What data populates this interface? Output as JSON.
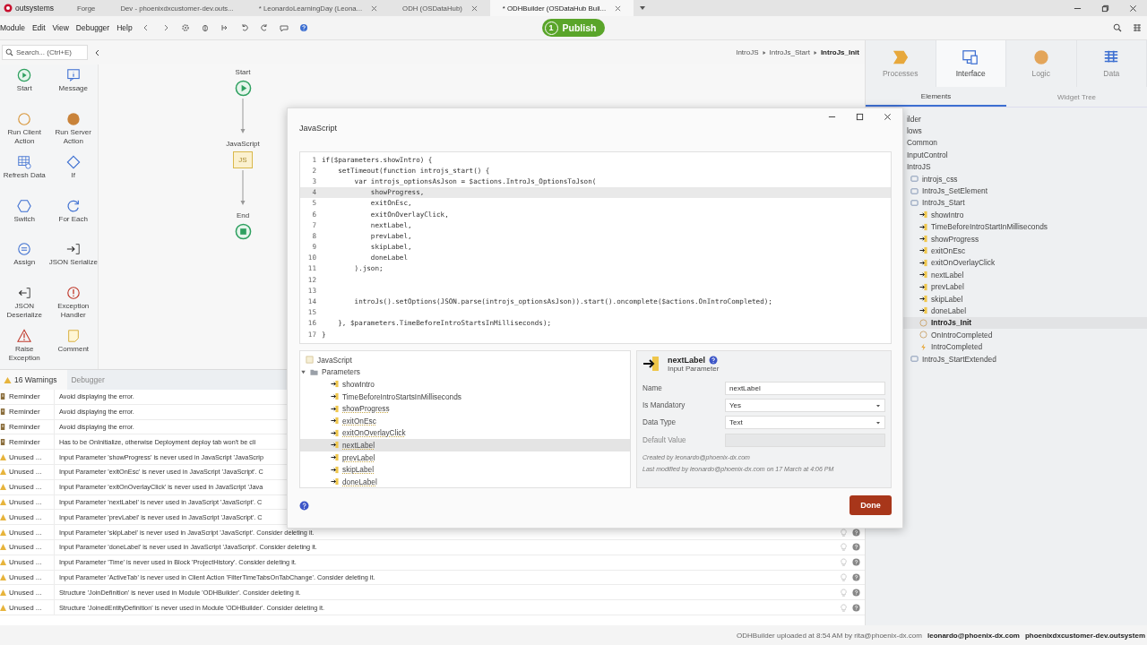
{
  "brand": "outsystems",
  "tabs": [
    {
      "label": "Forge",
      "selected": false,
      "closable": false
    },
    {
      "label": "Dev - phoenixdxcustomer-dev.outs...",
      "selected": false,
      "closable": false
    },
    {
      "label": "* LeonardoLearningDay (Leona...",
      "selected": false,
      "closable": true
    },
    {
      "label": "ODH (OSDataHub)",
      "selected": false,
      "closable": true
    },
    {
      "label": "* ODHBuilder (OSDataHub Buil...",
      "selected": true,
      "closable": true
    }
  ],
  "menu": [
    "Module",
    "Edit",
    "View",
    "Debugger",
    "Help"
  ],
  "publish": {
    "count": "1",
    "label": "Publish"
  },
  "search": {
    "placeholder": "Search... (Ctrl+E)"
  },
  "breadcrumb": [
    "IntroJS",
    "IntroJs_Start",
    "IntroJs_Init"
  ],
  "toolbox": [
    {
      "label": "Start",
      "kind": "start"
    },
    {
      "label": "Message",
      "kind": "message"
    },
    {
      "label": "Run Client Action",
      "kind": "client"
    },
    {
      "label": "Run Server Action",
      "kind": "server"
    },
    {
      "label": "Refresh Data",
      "kind": "refresh"
    },
    {
      "label": "If",
      "kind": "if"
    },
    {
      "label": "Switch",
      "kind": "switch"
    },
    {
      "label": "For Each",
      "kind": "foreach"
    },
    {
      "label": "Assign",
      "kind": "assign"
    },
    {
      "label": "JSON Serialize",
      "kind": "serialize"
    },
    {
      "label": "JSON Deserialize",
      "kind": "deserialize"
    },
    {
      "label": "Exception Handler",
      "kind": "exception"
    },
    {
      "label": "Raise Exception",
      "kind": "raise"
    },
    {
      "label": "Comment",
      "kind": "comment"
    }
  ],
  "flow": [
    {
      "label": "Start",
      "kind": "start"
    },
    {
      "label": "JavaScript",
      "kind": "js",
      "badge": "JS"
    },
    {
      "label": "End",
      "kind": "end"
    }
  ],
  "problems": {
    "tabs": [
      {
        "label": "16 Warnings",
        "selected": true
      },
      {
        "label": "Debugger",
        "selected": false
      }
    ],
    "rows": [
      {
        "kind": "reminder",
        "type": "Reminder",
        "message": "Avoid displaying the error."
      },
      {
        "kind": "reminder",
        "type": "Reminder",
        "message": "Avoid displaying the error."
      },
      {
        "kind": "reminder",
        "type": "Reminder",
        "message": "Avoid displaying the error."
      },
      {
        "kind": "reminder",
        "type": "Reminder",
        "message": "Has to be OnInitialize, otherwise Deployment deploy tab won't be cli"
      },
      {
        "kind": "unused",
        "type": "Unused ...",
        "message": "Input Parameter 'showProgress' is never used in JavaScript 'JavaScrip"
      },
      {
        "kind": "unused",
        "type": "Unused ...",
        "message": "Input Parameter 'exitOnEsc' is never used in JavaScript 'JavaScript'. C"
      },
      {
        "kind": "unused",
        "type": "Unused ...",
        "message": "Input Parameter 'exitOnOverlayClick' is never used in JavaScript 'Java"
      },
      {
        "kind": "unused",
        "type": "Unused ...",
        "message": "Input Parameter 'nextLabel' is never used in JavaScript 'JavaScript'. C"
      },
      {
        "kind": "unused",
        "type": "Unused ...",
        "message": "Input Parameter 'prevLabel' is never used in JavaScript 'JavaScript'. C"
      },
      {
        "kind": "unused",
        "type": "Unused ...",
        "message": "Input Parameter 'skipLabel' is never used in JavaScript 'JavaScript'. Consider deleting it."
      },
      {
        "kind": "unused",
        "type": "Unused ...",
        "message": "Input Parameter 'doneLabel' is never used in JavaScript 'JavaScript'. Consider deleting it."
      },
      {
        "kind": "unused",
        "type": "Unused ...",
        "message": "Input Parameter 'Time' is never used in Block 'ProjectHistory'. Consider deleting it."
      },
      {
        "kind": "unused",
        "type": "Unused ...",
        "message": "Input Parameter 'ActiveTab' is never used in Client Action 'FilterTimeTabsOnTabChange'. Consider deleting it."
      },
      {
        "kind": "unused",
        "type": "Unused ...",
        "message": "Structure 'JoinDefinition' is never used in Module 'ODHBuilder'. Consider deleting it."
      },
      {
        "kind": "unused",
        "type": "Unused ...",
        "message": "Structure 'JoinedEntityDefinition' is never used in Module 'ODHBuilder'. Consider deleting it."
      }
    ]
  },
  "right_panel": {
    "tabs": [
      {
        "label": "Processes",
        "kind": "processes",
        "selected": false
      },
      {
        "label": "Interface",
        "kind": "interface",
        "selected": true
      },
      {
        "label": "Logic",
        "kind": "logic",
        "selected": false
      },
      {
        "label": "Data",
        "kind": "data",
        "selected": false
      }
    ],
    "subtabs": [
      {
        "label": "Elements",
        "selected": true
      },
      {
        "label": "Widget Tree",
        "selected": false
      }
    ],
    "tree": [
      {
        "label": "ilder",
        "selected": false
      },
      {
        "label": "lows",
        "selected": false
      },
      {
        "label": "Common",
        "selected": false
      },
      {
        "label": "InputControl",
        "selected": false
      },
      {
        "label": "IntroJS",
        "selected": false,
        "children": [
          {
            "label": "introjs_css",
            "kind": "block",
            "selected": false
          },
          {
            "label": "IntroJs_SetElement",
            "kind": "block",
            "selected": false
          },
          {
            "label": "IntroJs_Start",
            "kind": "block",
            "selected": false,
            "children": [
              {
                "label": "showIntro",
                "kind": "param",
                "selected": false
              },
              {
                "label": "TimeBeforeIntroStartInMilliseconds",
                "kind": "param",
                "selected": false
              },
              {
                "label": "showProgress",
                "kind": "param",
                "selected": false
              },
              {
                "label": "exitOnEsc",
                "kind": "param",
                "selected": false
              },
              {
                "label": "exitOnOverlayClick",
                "kind": "param",
                "selected": false
              },
              {
                "label": "nextLabel",
                "kind": "param",
                "selected": false
              },
              {
                "label": "prevLabel",
                "kind": "param",
                "selected": false
              },
              {
                "label": "skipLabel",
                "kind": "param",
                "selected": false
              },
              {
                "label": "doneLabel",
                "kind": "param",
                "selected": false
              },
              {
                "label": "IntroJs_Init",
                "kind": "action",
                "selected": true
              },
              {
                "label": "OnIntroCompleted",
                "kind": "action",
                "selected": false
              },
              {
                "label": "IntroCompleted",
                "kind": "event",
                "selected": false
              }
            ]
          },
          {
            "label": "IntroJs_StartExtended",
            "kind": "block",
            "selected": false
          }
        ]
      }
    ]
  },
  "dialog": {
    "title": "JavaScript",
    "code": [
      {
        "n": "1",
        "text": "if($parameters.showIntro) {",
        "current": false
      },
      {
        "n": "2",
        "text": "    setTimeout(function introjs_start() {",
        "current": false
      },
      {
        "n": "3",
        "text": "        var introjs_optionsAsJson = $actions.IntroJs_OptionsToJson(",
        "current": false
      },
      {
        "n": "4",
        "text": "            showProgress,",
        "current": true
      },
      {
        "n": "5",
        "text": "            exitOnEsc,",
        "current": false
      },
      {
        "n": "6",
        "text": "            exitOnOverlayClick,",
        "current": false
      },
      {
        "n": "7",
        "text": "            nextLabel,",
        "current": false
      },
      {
        "n": "8",
        "text": "            prevLabel,",
        "current": false
      },
      {
        "n": "9",
        "text": "            skipLabel,",
        "current": false
      },
      {
        "n": "10",
        "text": "            doneLabel",
        "current": false
      },
      {
        "n": "11",
        "text": "        ).json;",
        "current": false
      },
      {
        "n": "12",
        "current": false
      },
      {
        "n": "13",
        "current": false
      },
      {
        "n": "14",
        "text": "        introJs().setOptions(JSON.parse(introjs_optionsAsJson)).start().oncomplete($actions.OnIntroCompleted);",
        "current": false
      },
      {
        "n": "15",
        "current": false
      },
      {
        "n": "16",
        "text": "    }, $parameters.TimeBeforeIntroStartsInMilliseconds);",
        "current": false
      },
      {
        "n": "17",
        "text": "}",
        "current": false
      }
    ],
    "tree": [
      {
        "label": "JavaScript",
        "kind": "js",
        "selected": false
      },
      {
        "label": "Parameters",
        "kind": "folder",
        "selected": false,
        "expanded": true,
        "children": [
          {
            "label": "showIntro",
            "kind": "param",
            "selected": false,
            "unused": false
          },
          {
            "label": "TimeBeforeIntroStartsInMilliseconds",
            "kind": "param",
            "selected": false,
            "unused": false
          },
          {
            "label": "showProgress",
            "kind": "param",
            "selected": false,
            "unused": true
          },
          {
            "label": "exitOnEsc",
            "kind": "param",
            "selected": false,
            "unused": true
          },
          {
            "label": "exitOnOverlayClick",
            "kind": "param",
            "selected": false,
            "unused": true
          },
          {
            "label": "nextLabel",
            "kind": "param",
            "selected": true,
            "unused": true
          },
          {
            "label": "prevLabel",
            "kind": "param",
            "selected": false,
            "unused": true
          },
          {
            "label": "skipLabel",
            "kind": "param",
            "selected": false,
            "unused": true
          },
          {
            "label": "doneLabel",
            "kind": "param",
            "selected": false,
            "unused": true
          }
        ]
      }
    ],
    "properties": {
      "name": "nextLabel",
      "type": "Input Parameter",
      "fields": [
        {
          "label": "Name",
          "kind": "text",
          "value": "nextLabel"
        },
        {
          "label": "Is Mandatory",
          "kind": "select",
          "value": "Yes"
        },
        {
          "label": "Data Type",
          "kind": "select",
          "value": "Text"
        },
        {
          "label": "Default Value",
          "kind": "disabled"
        }
      ],
      "created": "Created by leonardo@phoenix-dx.com",
      "modified": "Last modified by leonardo@phoenix-dx.com on 17 March at 4:06 PM"
    },
    "done": "Done"
  },
  "status": {
    "upload": "ODHBuilder uploaded at 8:54 AM by rita@phoenix-dx.com",
    "user": "leonardo@phoenix-dx.com",
    "server": "phoenixdxcustomer-dev.outsystem"
  }
}
